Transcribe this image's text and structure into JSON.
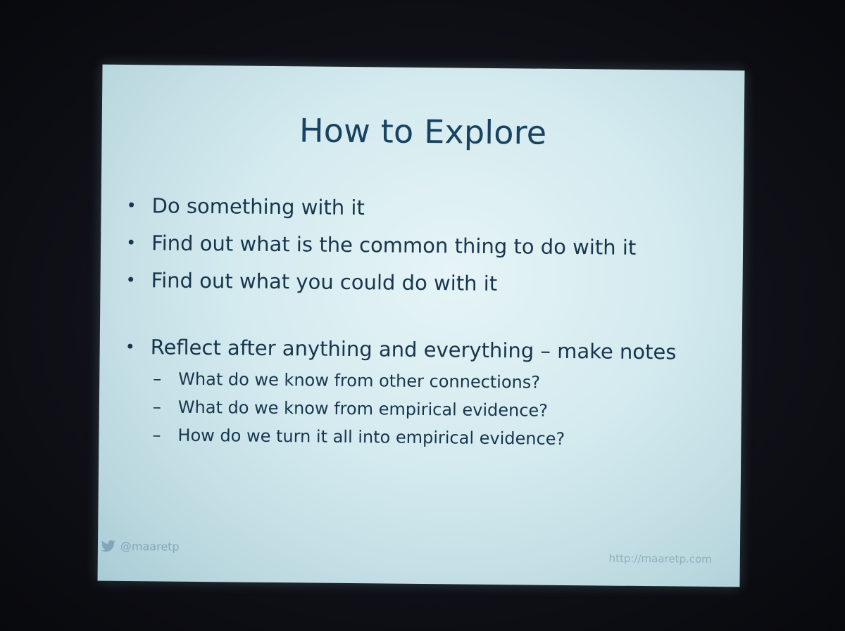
{
  "slide": {
    "title": "How to Explore",
    "bullets": [
      "Do something with it",
      "Find out what is the common thing to do with it",
      "Find out what you could do with it"
    ],
    "reflect": {
      "text": "Reflect after anything and everything – make notes",
      "sub_items": [
        "What do we know from other connections?",
        "What do we know from empirical evidence?",
        "How do we turn it all into empirical evidence?"
      ]
    },
    "bullet_glyph": "•",
    "sub_glyph": "–"
  },
  "footer": {
    "handle": "@maaretp",
    "url": "http://maaretp.com",
    "icon": "twitter-bird-icon"
  },
  "colors": {
    "slide_background": "#d3eaef",
    "text": "#17364d",
    "title": "#184261",
    "room": "#0b0c12"
  }
}
